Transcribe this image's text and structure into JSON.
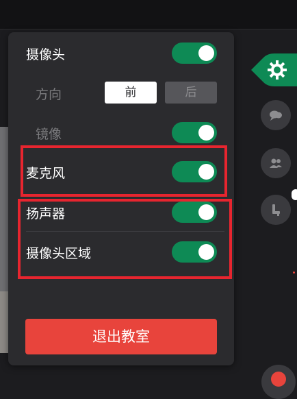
{
  "settings": {
    "camera": {
      "label": "摄像头",
      "enabled": true
    },
    "direction": {
      "label": "方向",
      "front_label": "前",
      "back_label": "后",
      "selected": "前"
    },
    "mirror": {
      "label": "镜像",
      "enabled": true
    },
    "microphone": {
      "label": "麦克风",
      "enabled": true
    },
    "speaker": {
      "label": "扬声器",
      "enabled": true
    },
    "camera_area": {
      "label": "摄像头区域",
      "enabled": true
    }
  },
  "exit_button": {
    "label": "退出教室"
  },
  "sidebar": {
    "items": [
      {
        "icon": "gear-icon",
        "active": true
      },
      {
        "icon": "chat-icon",
        "active": false
      },
      {
        "icon": "users-icon",
        "active": false
      },
      {
        "icon": "seat-icon",
        "active": false
      }
    ]
  },
  "colors": {
    "panel_bg": "#2b2b2e",
    "toggle_on": "#0e8a55",
    "exit_red": "#e8443c",
    "highlight_red": "#e7252f",
    "active_tab": "#0e8a55"
  }
}
